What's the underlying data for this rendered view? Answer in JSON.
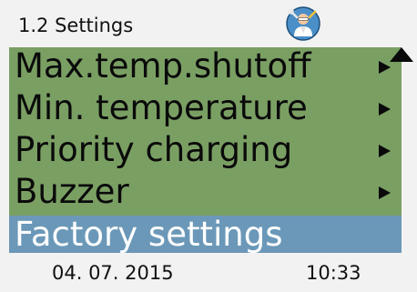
{
  "header": {
    "title": "1.2 Settings",
    "service_icon": "technician-icon"
  },
  "menu": {
    "items": [
      {
        "label": "Max.temp.shutoff",
        "has_submenu": true,
        "selected": false
      },
      {
        "label": "Min. temperature",
        "has_submenu": true,
        "selected": false
      },
      {
        "label": "Priority charging",
        "has_submenu": true,
        "selected": false
      },
      {
        "label": "Buzzer",
        "has_submenu": true,
        "selected": false
      },
      {
        "label": "Factory settings",
        "has_submenu": false,
        "selected": true
      }
    ],
    "scroll_indicator": "scroll-up-arrow"
  },
  "footer": {
    "date": "04. 07. 2015",
    "time": "10:33"
  },
  "colors": {
    "menu_bg": "#7a9f63",
    "selected_bg": "#6b98b8",
    "page_bg": "#f2f2f2",
    "icon_bg": "#4a8fc8"
  }
}
